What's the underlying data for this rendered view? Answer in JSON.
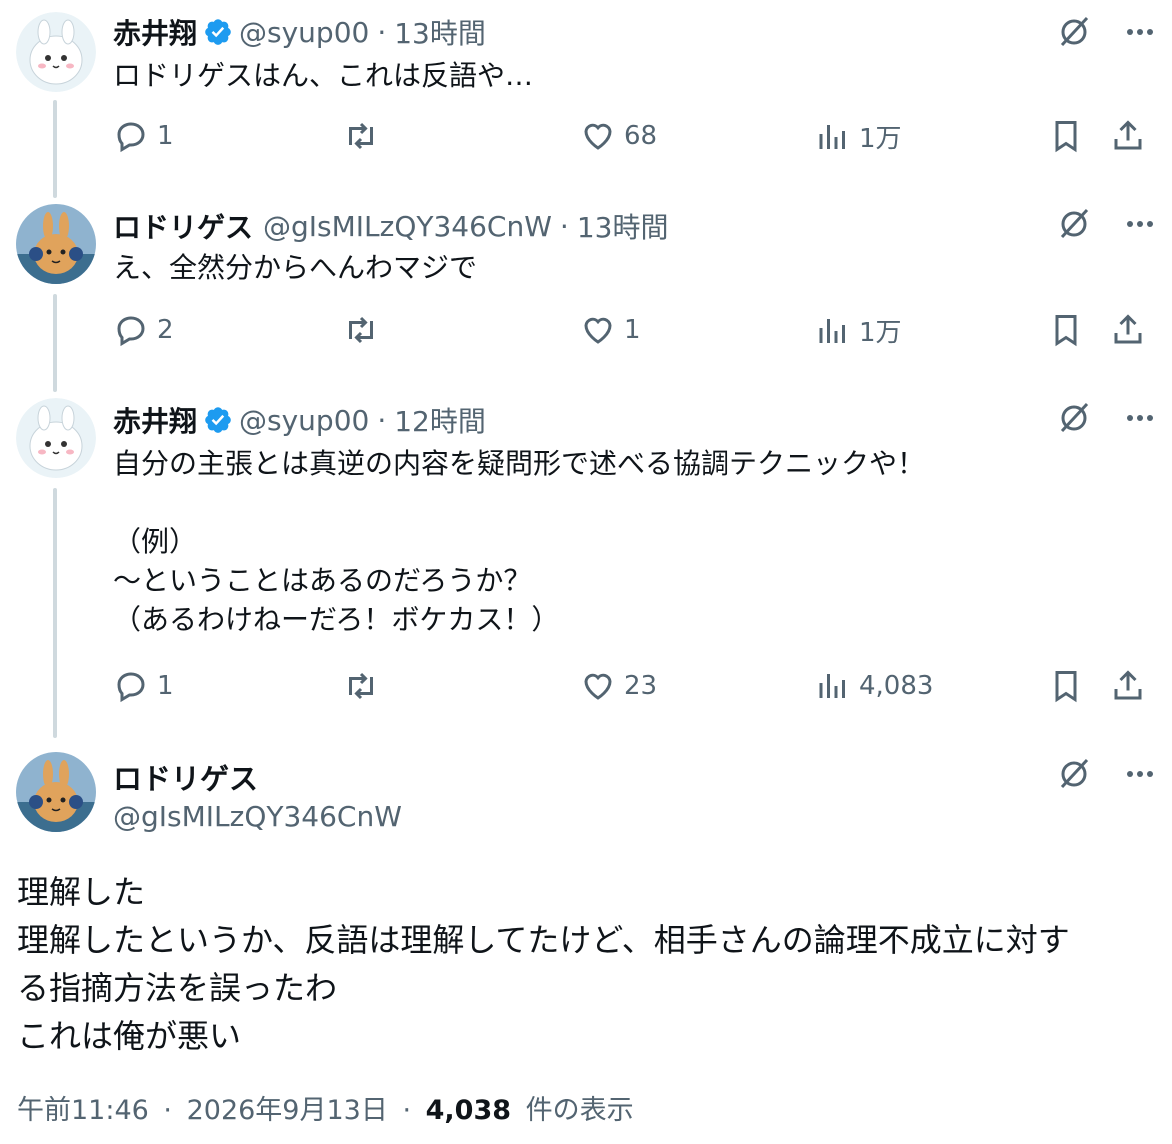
{
  "tweets": [
    {
      "name": "赤井翔",
      "handle": "@syup00",
      "time": "13時間",
      "verified": true,
      "text": "ロドリゲスはん、これは反語や…",
      "replies": "1",
      "retweets": "",
      "likes": "68",
      "views": "1万"
    },
    {
      "name": "ロドリゲス",
      "handle": "@gIsMILzQY346CnW",
      "time": "13時間",
      "verified": false,
      "text": "え、全然分からへんわマジで",
      "replies": "2",
      "retweets": "",
      "likes": "1",
      "views": "1万"
    },
    {
      "name": "赤井翔",
      "handle": "@syup00",
      "time": "12時間",
      "verified": true,
      "text": "自分の主張とは真逆の内容を疑問形で述べる協調テクニックや！\n\n（例）\n〜ということはあるのだろうか？\n（あるわけねーだろ！ボケカス！）",
      "replies": "1",
      "retweets": "",
      "likes": "23",
      "views": "4,083"
    }
  ],
  "main": {
    "name": "ロドリゲス",
    "handle": "@gIsMILzQY346CnW",
    "text": "理解した\n理解したというか、反語は理解してたけど、相手さんの論理不成立に対す\nる指摘方法を誤ったわ\nこれは俺が悪い",
    "time": "午前11:46",
    "date": "2026年9月13日",
    "views_count": "4,038",
    "views_label": "件の表示"
  },
  "meta_separator": "·",
  "colors": {
    "verified": "#1d9bf0",
    "secondary": "#536471",
    "thread_line": "#cfd9de"
  },
  "icons": [
    "reply-icon",
    "retweet-icon",
    "like-icon",
    "views-icon",
    "bookmark-icon",
    "share-icon",
    "grok-icon",
    "more-icon",
    "verified-badge-icon"
  ]
}
